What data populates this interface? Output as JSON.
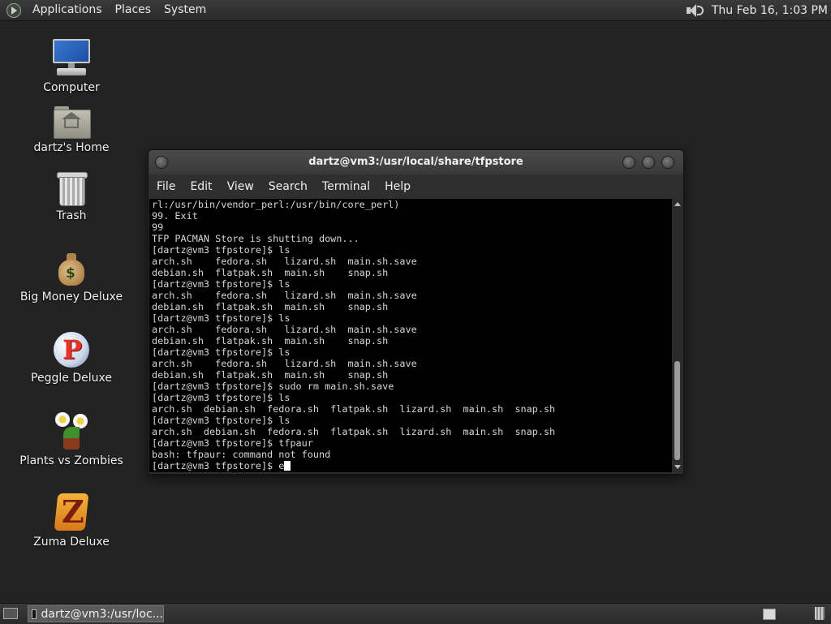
{
  "top_panel": {
    "menu": [
      "Applications",
      "Places",
      "System"
    ],
    "clock": "Thu Feb 16,  1:03 PM",
    "volume_icon": "speaker-icon"
  },
  "desktop_icons": [
    {
      "label": "Computer",
      "icon": "computer-icon"
    },
    {
      "label": "dartz's Home",
      "icon": "home-folder-icon"
    },
    {
      "label": "Trash",
      "icon": "trash-icon"
    },
    {
      "label": "Big Money Deluxe",
      "icon": "money-bag-icon"
    },
    {
      "label": "Peggle Deluxe",
      "icon": "peggle-icon"
    },
    {
      "label": "Plants vs Zombies",
      "icon": "plants-icon"
    },
    {
      "label": "Zuma Deluxe",
      "icon": "zuma-icon"
    }
  ],
  "terminal": {
    "title": "dartz@vm3:/usr/local/share/tfpstore",
    "menu": [
      "File",
      "Edit",
      "View",
      "Search",
      "Terminal",
      "Help"
    ],
    "lines": [
      "rl:/usr/bin/vendor_perl:/usr/bin/core_perl)",
      "99. Exit",
      "99",
      "TFP PACMAN Store is shutting down...",
      "[dartz@vm3 tfpstore]$ ls",
      "arch.sh    fedora.sh   lizard.sh  main.sh.save",
      "debian.sh  flatpak.sh  main.sh    snap.sh",
      "[dartz@vm3 tfpstore]$ ls",
      "arch.sh    fedora.sh   lizard.sh  main.sh.save",
      "debian.sh  flatpak.sh  main.sh    snap.sh",
      "[dartz@vm3 tfpstore]$ ls",
      "arch.sh    fedora.sh   lizard.sh  main.sh.save",
      "debian.sh  flatpak.sh  main.sh    snap.sh",
      "[dartz@vm3 tfpstore]$ ls",
      "arch.sh    fedora.sh   lizard.sh  main.sh.save",
      "debian.sh  flatpak.sh  main.sh    snap.sh",
      "[dartz@vm3 tfpstore]$ sudo rm main.sh.save",
      "[dartz@vm3 tfpstore]$ ls",
      "arch.sh  debian.sh  fedora.sh  flatpak.sh  lizard.sh  main.sh  snap.sh",
      "[dartz@vm3 tfpstore]$ ls",
      "arch.sh  debian.sh  fedora.sh  flatpak.sh  lizard.sh  main.sh  snap.sh",
      "[dartz@vm3 tfpstore]$ tfpaur",
      "bash: tfpaur: command not found"
    ],
    "prompt_line": "[dartz@vm3 tfpstore]$ e"
  },
  "bottom_panel": {
    "task_label": "dartz@vm3:/usr/loc..."
  }
}
